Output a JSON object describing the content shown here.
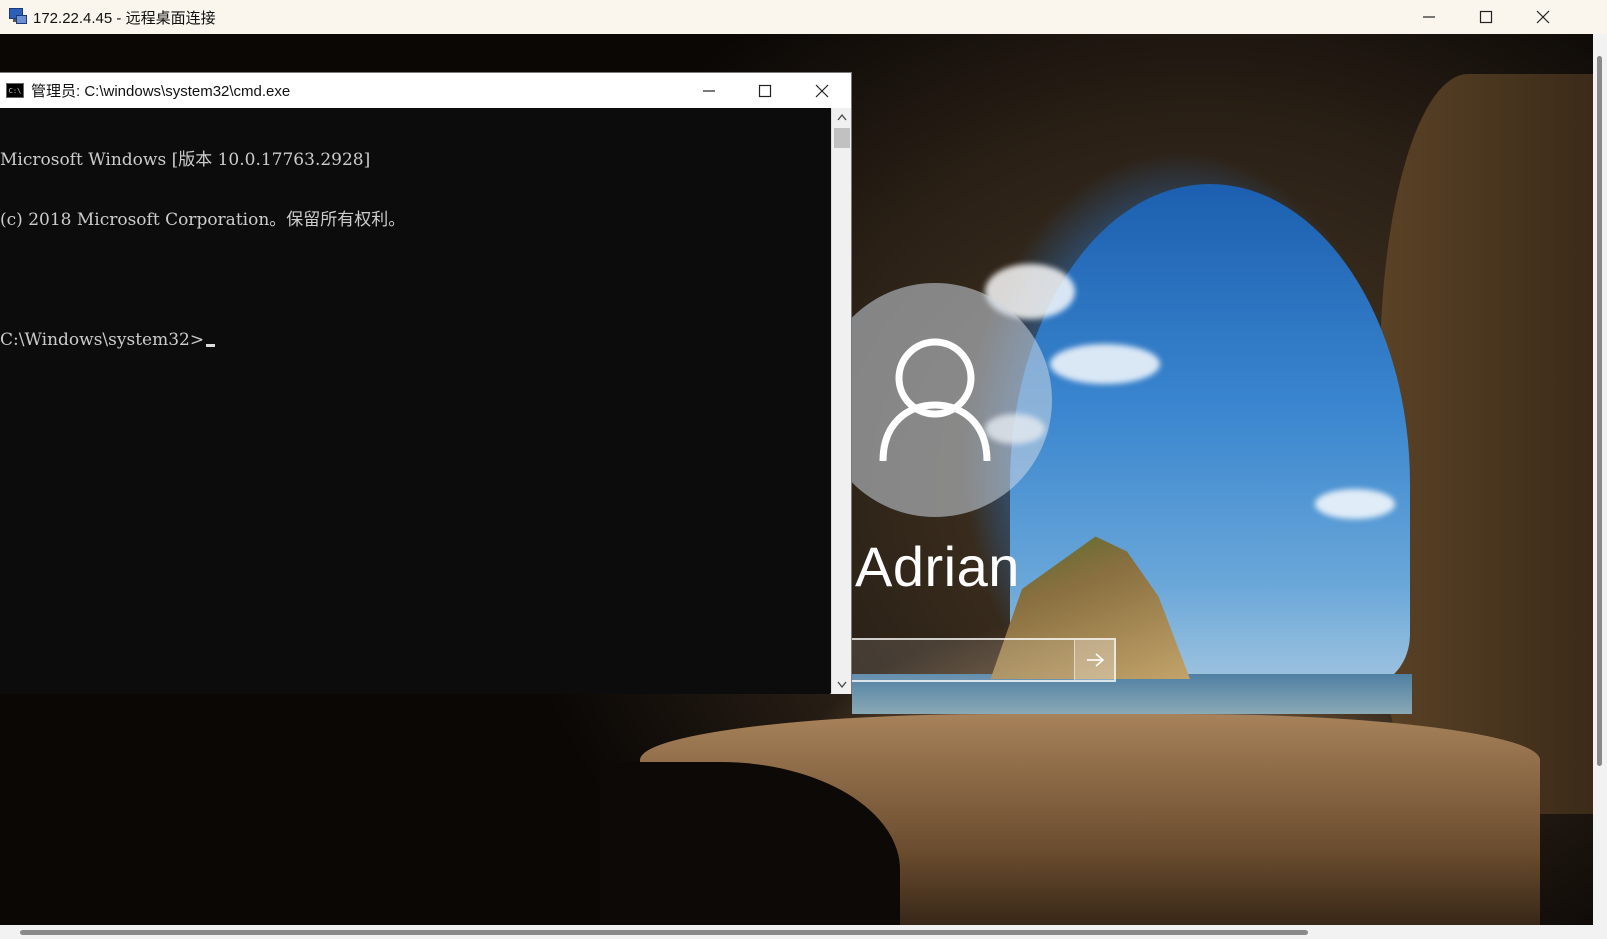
{
  "rdp": {
    "title": "172.22.4.45 - 远程桌面连接",
    "icon": "remote-desktop-icon",
    "controls": {
      "minimize": "minimize-icon",
      "maximize": "maximize-icon",
      "close": "close-icon"
    }
  },
  "cmd": {
    "title": "管理员: C:\\windows\\system32\\cmd.exe",
    "icon_text": "C:\\",
    "lines": [
      "Microsoft Windows [版本 10.0.17763.2928]",
      "(c) 2018 Microsoft Corporation。保留所有权利。",
      "",
      "C:\\Windows\\system32>"
    ]
  },
  "login": {
    "username": "Adrian",
    "password_placeholder": "",
    "submit_icon": "arrow-right-icon",
    "avatar_icon": "user-avatar-icon"
  },
  "colors": {
    "console_bg": "#0c0c0c",
    "console_text": "#cccccc",
    "titlebar_bg": "#faf6ee"
  }
}
